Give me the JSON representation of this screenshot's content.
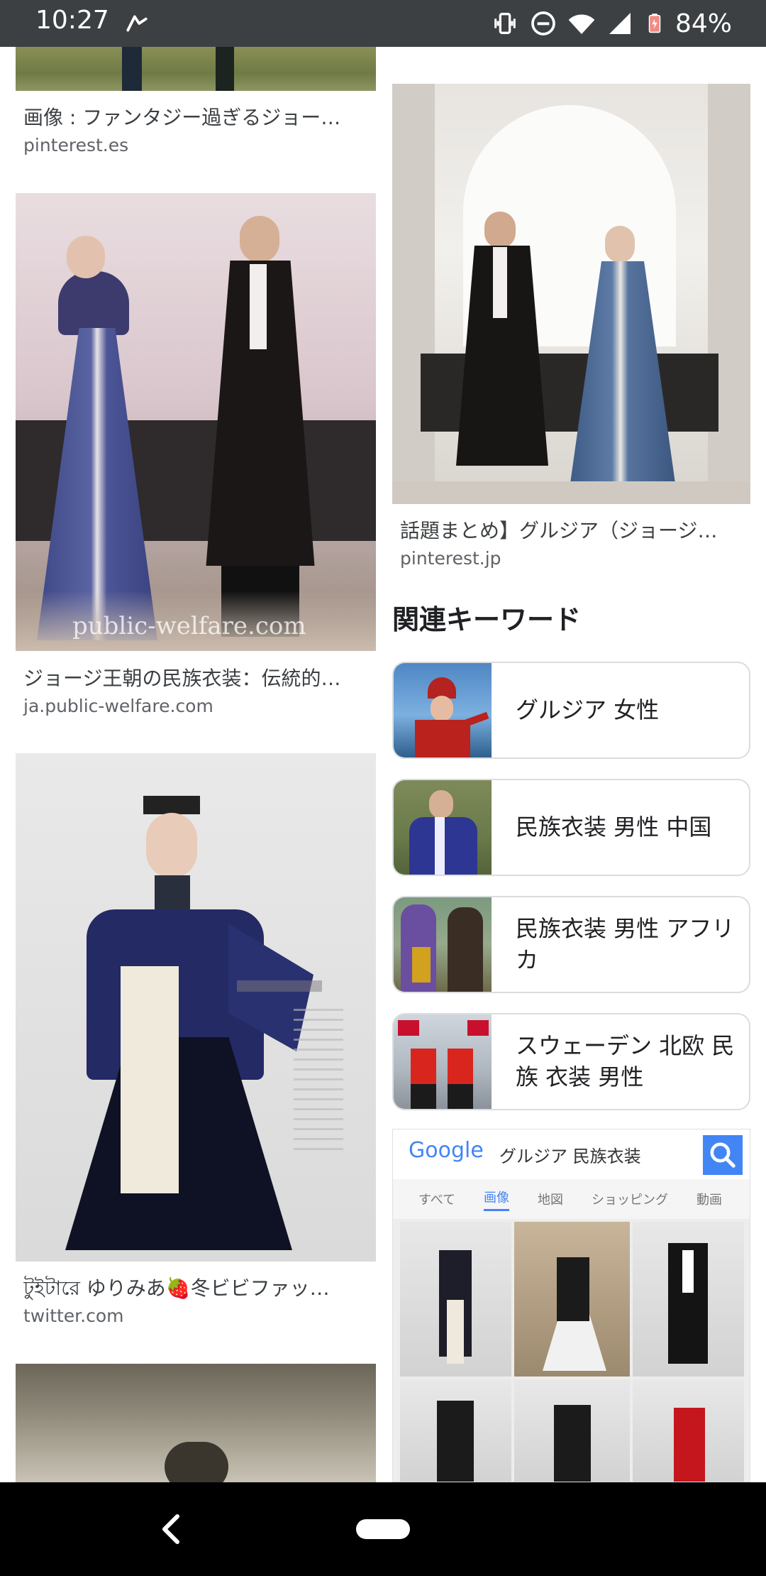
{
  "status_bar": {
    "time": "10:27",
    "battery": "84%",
    "icons": [
      "navigation-arrow-icon",
      "vibrate-icon",
      "do-not-disturb-icon",
      "wifi-icon",
      "signal-icon",
      "battery-icon"
    ]
  },
  "results_left": [
    {
      "caption": "画像 : ファンタジー過ぎるジョー…",
      "source": "pinterest.es"
    },
    {
      "caption": "ジョージ王朝の民族衣装：伝統的…",
      "source": "ja.public-welfare.com",
      "watermark": "public-welfare.com"
    },
    {
      "caption": "টুইটারে ゆりみあ🍓冬ビビファッ…",
      "source": "twitter.com"
    }
  ],
  "results_right": [
    {
      "caption": "話題まとめ】グルジア（ジョージ…",
      "source": "pinterest.jp"
    }
  ],
  "related": {
    "title": "関連キーワード",
    "items": [
      {
        "label": "グルジア 女性"
      },
      {
        "label": "民族衣装 男性 中国"
      },
      {
        "label": "民族衣装 男性 アフリカ"
      },
      {
        "label": "スウェーデン 北欧 民族 衣装 男性"
      }
    ]
  },
  "screenshot_tile": {
    "logo": "Google",
    "query": "グルジア 民族衣装",
    "tabs": [
      "すべて",
      "画像",
      "地図",
      "ショッピング",
      "動画"
    ],
    "active_tab": "画像"
  },
  "colors": {
    "status_bar": "#3c4043",
    "nav_bar": "#000000",
    "border": "#dadce0",
    "google_blue": "#4285f4"
  }
}
